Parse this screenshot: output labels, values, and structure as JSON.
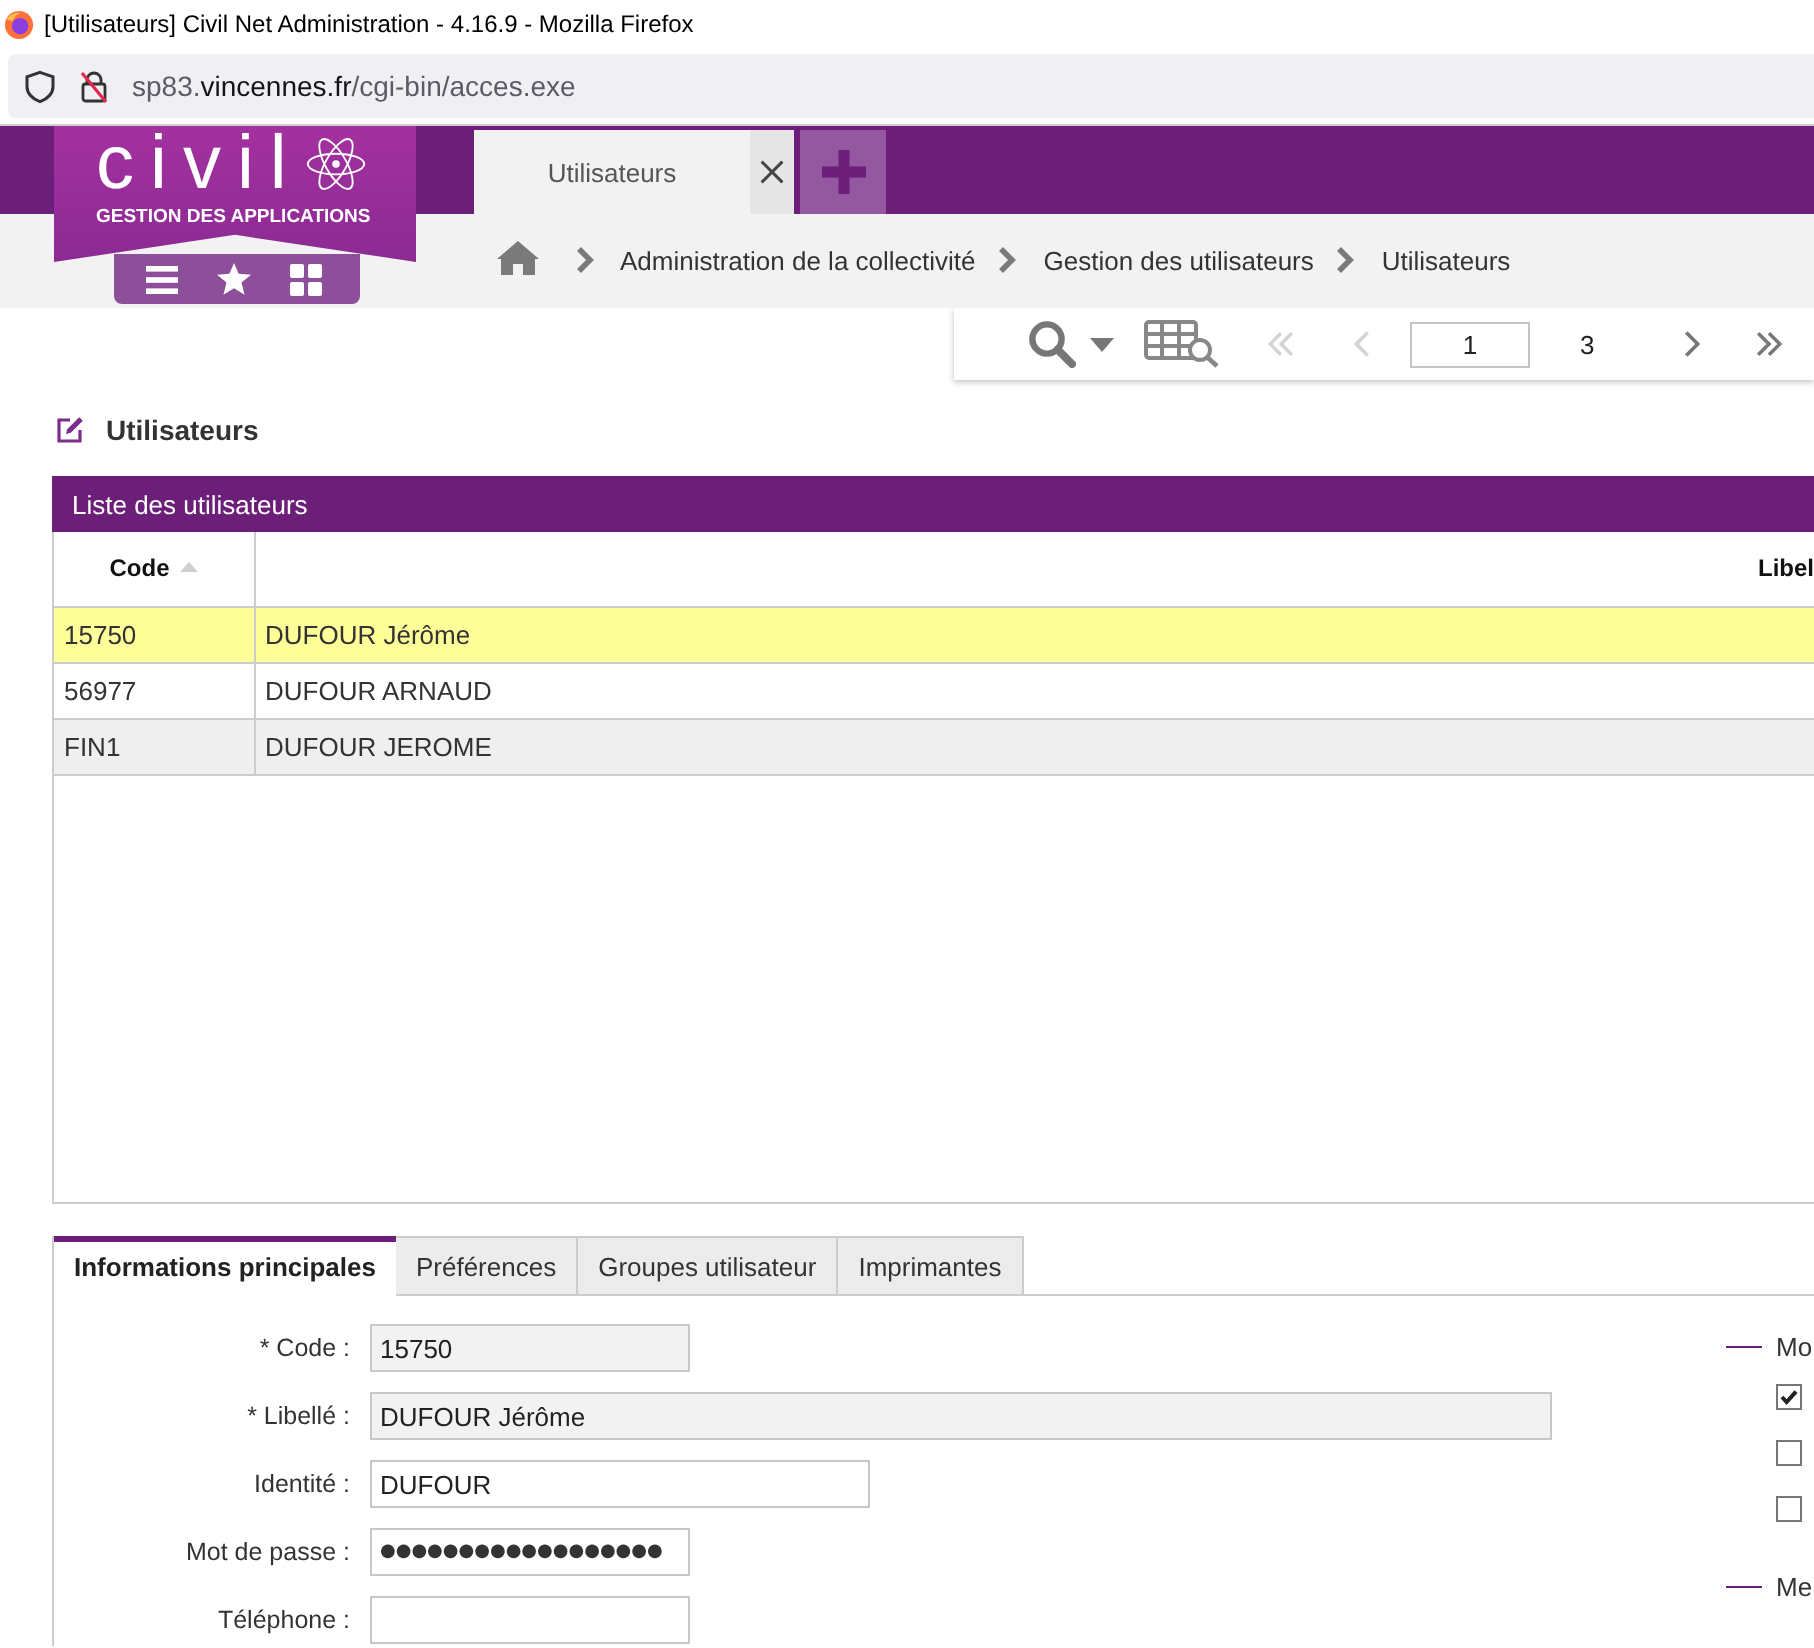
{
  "browser": {
    "title": "[Utilisateurs] Civil Net Administration - 4.16.9 - Mozilla Firefox",
    "url": {
      "subdomain": "sp83.",
      "domain": "vincennes.fr",
      "path": "/cgi-bin/acces.exe"
    }
  },
  "app_header": {
    "logo": {
      "wordmark": "civil",
      "tagline": "GESTION DES APPLICATIONS"
    },
    "tabs": [
      {
        "label": "Utilisateurs",
        "selected": true
      }
    ]
  },
  "breadcrumb": [
    "Administration de la collectivité",
    "Gestion des utilisateurs",
    "Utilisateurs"
  ],
  "pager": {
    "page": "1",
    "page_count": "3",
    "buttons": [
      {
        "kind": "first",
        "disabled": true
      },
      {
        "kind": "previous",
        "disabled": true
      },
      {
        "kind": "next",
        "disabled": false
      },
      {
        "kind": "last",
        "disabled": false
      }
    ]
  },
  "page_title": "Utilisateurs",
  "user_list": {
    "title": "Liste des utilisateurs",
    "columns": [
      {
        "label": "Code",
        "sorted_ascending": true
      },
      {
        "label": "Libel"
      }
    ],
    "rows": [
      {
        "cells": [
          "15750",
          "DUFOUR Jérôme"
        ],
        "selected": true
      },
      {
        "cells": [
          "56977",
          "DUFOUR ARNAUD"
        ],
        "selected": false
      },
      {
        "cells": [
          "FIN1",
          "DUFOUR JEROME"
        ],
        "selected": false
      }
    ]
  },
  "detail_tabs": [
    {
      "label": "Informations principales",
      "selected": true
    },
    {
      "label": "Préférences",
      "selected": false
    },
    {
      "label": "Groupes utilisateur",
      "selected": false
    },
    {
      "label": "Imprimantes",
      "selected": false
    }
  ],
  "form_fields": [
    {
      "label": "* Code :",
      "value": "15750",
      "kind": "text",
      "readonly": true
    },
    {
      "label": "* Libellé :",
      "value": "DUFOUR Jérôme",
      "kind": "text",
      "readonly": true
    },
    {
      "label": "Identité :",
      "value": "DUFOUR",
      "kind": "text",
      "readonly": false
    },
    {
      "label": "Mot de passe :",
      "value": "●●●●●●●●●●●●●●●●●●",
      "kind": "password",
      "readonly": false
    },
    {
      "label": "Téléphone :",
      "kind": "text",
      "readonly": false
    }
  ],
  "option_groups": [
    {
      "legend": "Mo",
      "checkboxes": [
        {
          "checked": true
        },
        {
          "checked": false
        },
        {
          "checked": false
        }
      ]
    },
    {
      "legend": "Me"
    }
  ]
}
